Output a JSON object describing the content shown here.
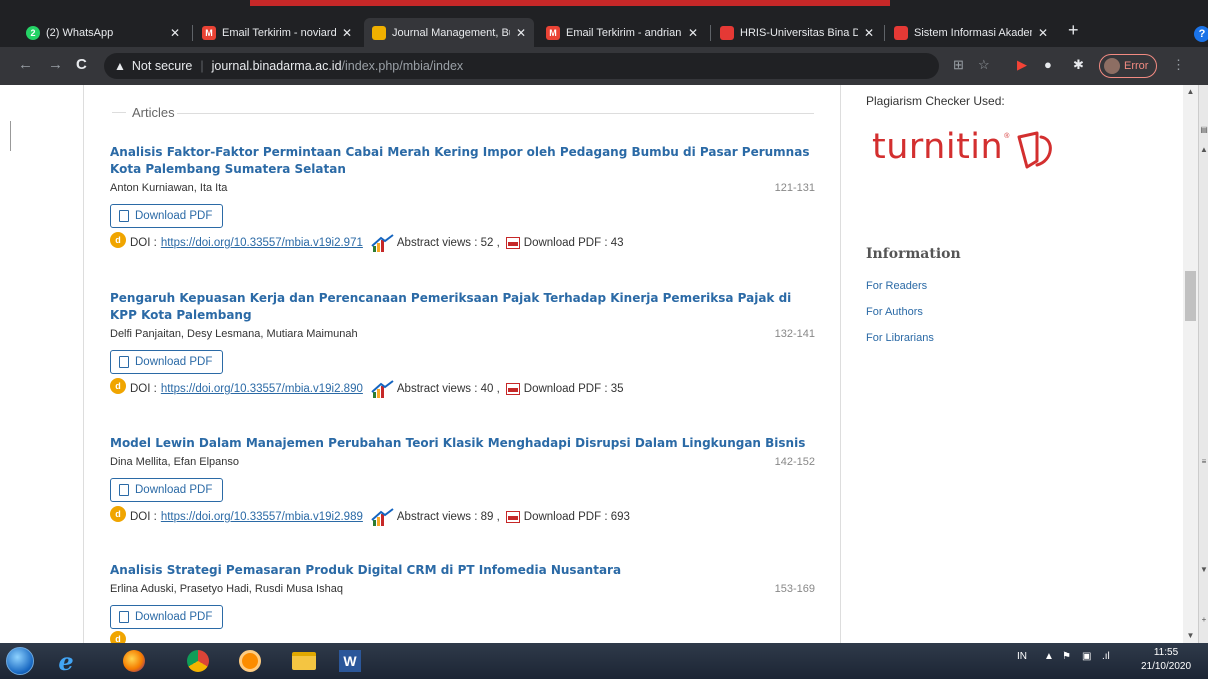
{
  "browser": {
    "tabs": [
      {
        "title": "(2) WhatsApp",
        "icon": "whatsapp-icon",
        "color": "#25d366",
        "glyph": "2"
      },
      {
        "title": "Email Terkirim - noviardy",
        "icon": "gmail-icon",
        "color": "#ea4335",
        "glyph": "M"
      },
      {
        "title": "Journal Management, Bu",
        "icon": "journal-favicon",
        "color": "#f0b000",
        "glyph": ""
      },
      {
        "title": "Email Terkirim - andrian.r",
        "icon": "gmail-icon",
        "color": "#ea4335",
        "glyph": "M"
      },
      {
        "title": "HRIS-Universitas Bina Da",
        "icon": "hris-favicon",
        "color": "#e53935",
        "glyph": ""
      },
      {
        "title": "Sistem Informasi Akadem",
        "icon": "siakad-favicon",
        "color": "#e53935",
        "glyph": ""
      }
    ],
    "new_tab": "+",
    "help": "?",
    "url_warning": "Not secure",
    "url_host": "journal.binadarma.ac.id",
    "url_path": "/index.php/mbia/index",
    "profile_label": "Error"
  },
  "page": {
    "section_heading": "Articles",
    "articles": [
      {
        "title": "Analisis Faktor-Faktor Permintaan Cabai Merah Kering Impor oleh Pedagang Bumbu di Pasar Perumnas Kota Palembang Sumatera Selatan",
        "authors": "Anton Kurniawan, Ita Ita",
        "pages": "121-131",
        "download": "Download PDF",
        "doi_label": "DOI :",
        "doi": "https://doi.org/10.33557/mbia.v19i2.971",
        "abstract_views": "Abstract views : 52 ,",
        "pdf_downloads": "Download PDF : 43"
      },
      {
        "title": "Pengaruh Kepuasan Kerja dan Perencanaan Pemeriksaan Pajak Terhadap Kinerja Pemeriksa Pajak di KPP Kota Palembang",
        "authors": "Delfi Panjaitan, Desy Lesmana, Mutiara Maimunah",
        "pages": "132-141",
        "download": "Download PDF",
        "doi_label": "DOI :",
        "doi": "https://doi.org/10.33557/mbia.v19i2.890",
        "abstract_views": "Abstract views : 40 ,",
        "pdf_downloads": "Download PDF : 35"
      },
      {
        "title": "Model Lewin Dalam Manajemen Perubahan Teori Klasik Menghadapi Disrupsi Dalam Lingkungan Bisnis",
        "authors": "Dina Mellita, Efan Elpanso",
        "pages": "142-152",
        "download": "Download PDF",
        "doi_label": "DOI :",
        "doi": "https://doi.org/10.33557/mbia.v19i2.989",
        "abstract_views": "Abstract views : 89 ,",
        "pdf_downloads": "Download PDF : 693"
      },
      {
        "title": "Analisis Strategi Pemasaran Produk Digital CRM di PT Infomedia Nusantara",
        "authors": "Erlina Aduski, Prasetyo Hadi, Rusdi Musa Ishaq",
        "pages": "153-169",
        "download": "Download PDF"
      }
    ]
  },
  "sidebar": {
    "plagiarism_label": "Plagiarism Checker Used:",
    "turnitin_logo": "turnitin",
    "info_title": "Information",
    "links": [
      "For Readers",
      "For Authors",
      "For Librarians"
    ]
  },
  "taskbar": {
    "lang": "IN",
    "time": "11:55",
    "date": "21/10/2020"
  }
}
